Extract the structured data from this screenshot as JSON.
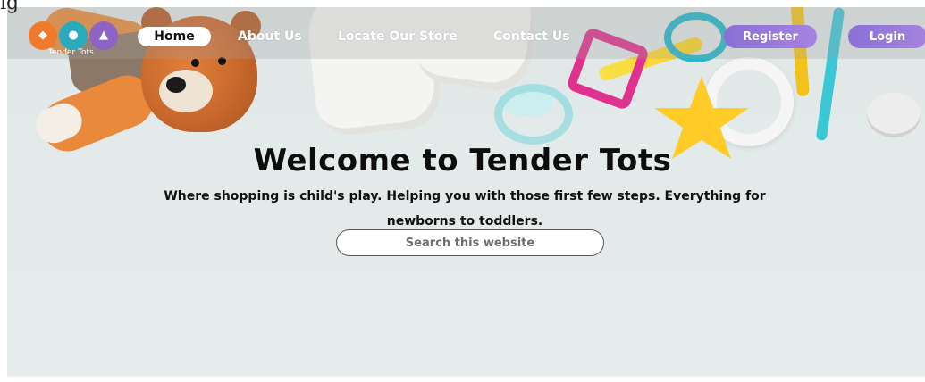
{
  "caption_fragment": "ig",
  "brand": {
    "name": "Tender Tots",
    "colors": [
      "#f07a2b",
      "#2aaabd",
      "#8e63c4"
    ]
  },
  "nav": {
    "links": [
      "Home",
      "About Us",
      "Locate Our Store",
      "Contact Us"
    ],
    "active": "Home",
    "register_label": "Register",
    "login_label": "Login",
    "accent": "#9b79dd"
  },
  "hero": {
    "title": "Welcome to Tender Tots",
    "subtitle": "Where shopping is child's play. Helping you with those first few steps. Everything for newborns to toddlers.",
    "search_placeholder": "Search this website"
  }
}
